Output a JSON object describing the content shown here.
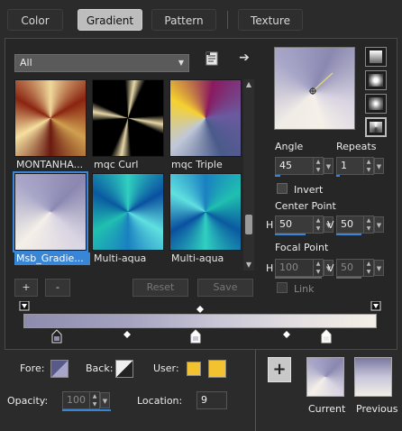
{
  "tabs": [
    {
      "label": "Color"
    },
    {
      "label": "Gradient"
    },
    {
      "label": "Pattern"
    },
    {
      "label": "Texture"
    }
  ],
  "category": {
    "selected": "All"
  },
  "thumbnails": [
    {
      "label": "MONTANHA..."
    },
    {
      "label": "mqc Curl"
    },
    {
      "label": "mqc Triple"
    },
    {
      "label": "Msb_Gradie..."
    },
    {
      "label": "Multi-aqua"
    },
    {
      "label": "Multi-aqua"
    }
  ],
  "buttons": {
    "plus": "+",
    "minus": "-",
    "reset": "Reset",
    "save": "Save"
  },
  "angle": {
    "label": "Angle",
    "value": "45"
  },
  "repeats": {
    "label": "Repeats",
    "value": "1"
  },
  "invert": {
    "label": "Invert"
  },
  "center_point": {
    "label": "Center Point",
    "h_label": "H",
    "h_value": "50",
    "v_label": "V",
    "v_value": "50"
  },
  "focal_point": {
    "label": "Focal Point",
    "h_label": "H",
    "h_value": "100",
    "v_label": "V",
    "v_value": "50"
  },
  "link": {
    "label": "Link"
  },
  "fore": {
    "label": "Fore:"
  },
  "back": {
    "label": "Back:"
  },
  "user": {
    "label": "User:",
    "color": "#f2c230"
  },
  "opacity": {
    "label": "Opacity:",
    "value": "100"
  },
  "location": {
    "label": "Location:",
    "value": "9"
  },
  "add_button": "+",
  "current": {
    "label": "Current"
  },
  "previous": {
    "label": "Previous"
  },
  "colors": {
    "accent": "#3a86d6",
    "gradient_start": "#8e8cae",
    "gradient_end": "#f4efe6"
  }
}
